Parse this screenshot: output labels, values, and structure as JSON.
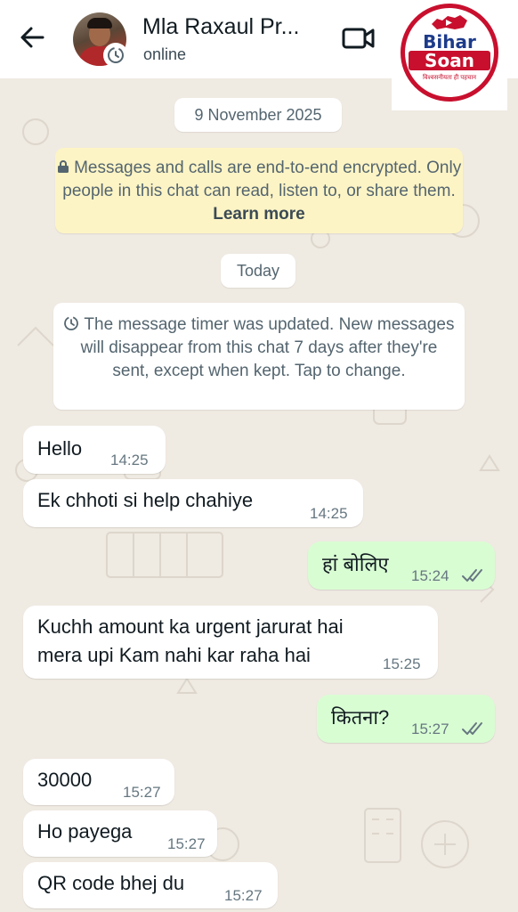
{
  "header": {
    "contact_name": "Mla Raxaul Pr...",
    "status": "online",
    "icons": {
      "back": "back-arrow-icon",
      "video": "video-call-icon",
      "timer": "disappearing-timer-icon"
    }
  },
  "watermark": {
    "line1": "Bihar",
    "line2": "Soan",
    "tagline": "विश्वसनीयता ही पहचान"
  },
  "chat": {
    "date_label": "9 November 2025",
    "encryption_notice": "Messages and calls are end-to-end encrypted. Only people in this chat can read, listen to, or share them.",
    "learn_more": "Learn more",
    "today_label": "Today",
    "timer_notice": "The message timer was updated. New messages will disappear from this chat 7 days after they're sent, except when kept. Tap to change.",
    "messages": [
      {
        "dir": "in",
        "text": "Hello",
        "time": "14:25"
      },
      {
        "dir": "in",
        "text": "Ek chhoti si help chahiye",
        "time": "14:25"
      },
      {
        "dir": "out",
        "text": "हां बोलिए",
        "time": "15:24",
        "status": "read"
      },
      {
        "dir": "in",
        "text_line1": "Kuchh amount ka urgent jarurat hai",
        "text_line2": "mera upi Kam nahi kar raha hai",
        "time": "15:25"
      },
      {
        "dir": "out",
        "text": "कितना?",
        "time": "15:27",
        "status": "read"
      },
      {
        "dir": "in",
        "text": "30000",
        "time": "15:27"
      },
      {
        "dir": "in",
        "text": "Ho payega",
        "time": "15:27"
      },
      {
        "dir": "in",
        "text": "QR code bhej du",
        "time": "15:27"
      }
    ]
  },
  "colors": {
    "chat_background": "#efeae2",
    "incoming_bubble": "#ffffff",
    "outgoing_bubble": "#d9fdd3",
    "encryption_notice_bg": "#fdf4c5",
    "read_ticks": "#667781",
    "watermark_red": "#c8102e",
    "watermark_blue": "#1d3b8a"
  }
}
